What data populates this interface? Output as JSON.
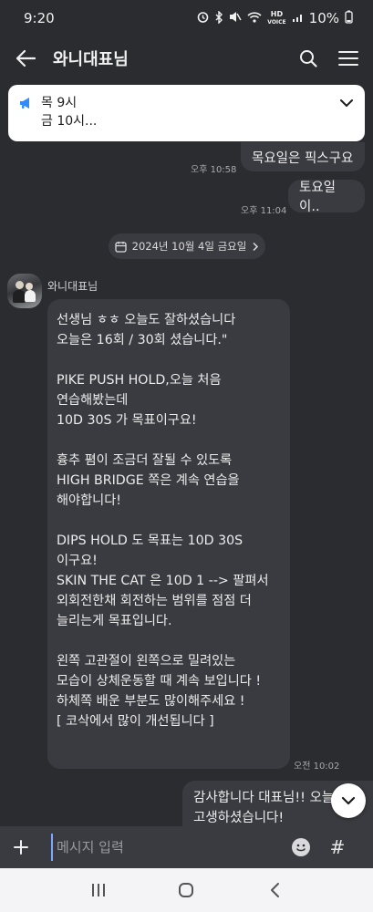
{
  "status_bar": {
    "time": "9:20",
    "hd_line1": "HD",
    "hd_line2": "VOICE",
    "battery": "10%"
  },
  "header": {
    "title": "와니대표님"
  },
  "notice": {
    "line1": "목 9시",
    "line2": "금 10시..."
  },
  "messages_top": [
    {
      "text": "목요일은 픽스구요",
      "time": "오후 10:58"
    },
    {
      "text": "토요일이..",
      "time": "오후 11:04"
    }
  ],
  "date_divider": "2024년 10월 4일 금요일",
  "incoming": {
    "sender": "와니대표님",
    "lines": [
      "선생님 ㅎㅎ 오늘도 잘하셨습니다",
      "오늘은 16회 / 30회 셨습니다.\"",
      "",
      "PIKE PUSH HOLD,오늘 처음",
      "연습해봤는데",
      "10D 30S 가 목표이구요!",
      "",
      "흉추 폄이 조금더 잘될 수 있도록",
      "HIGH BRIDGE 쪽은 계속 연습을",
      "해야합니다!",
      "",
      "DIPS HOLD 도 목표는 10D 30S",
      "이구요!",
      "SKIN THE CAT 은 10D 1 --> 팔펴서",
      "외회전한채 회전하는 범위를 점점 더",
      "늘리는게 목표입니다.",
      "",
      "왼쪽 고관절이 왼쪽으로 밀려있는",
      "모습이 상체운동할 때 계속 보입니다 !",
      "하체쪽 배운 부분도 많이해주세요 !",
      "[ 코삭에서 많이 개선됩니다 ]"
    ],
    "time": "오전 10:02"
  },
  "outgoing_bottom": {
    "line1": "감사합니다 대표님!!  오늘",
    "line2": "고생하셨습니다!"
  },
  "input": {
    "placeholder": "메시지 입력",
    "hash": "#"
  },
  "icons": {
    "back": "arrow-left",
    "search": "magnifier",
    "menu": "hamburger",
    "notice": "megaphone",
    "chevron": "chevron-down",
    "plus": "plus",
    "emoji": "smiley",
    "scroll": "chevron-down"
  },
  "colors": {
    "background": "#2b2c30",
    "bubble": "#3a3b40",
    "notice_icon": "#2f8cff"
  }
}
